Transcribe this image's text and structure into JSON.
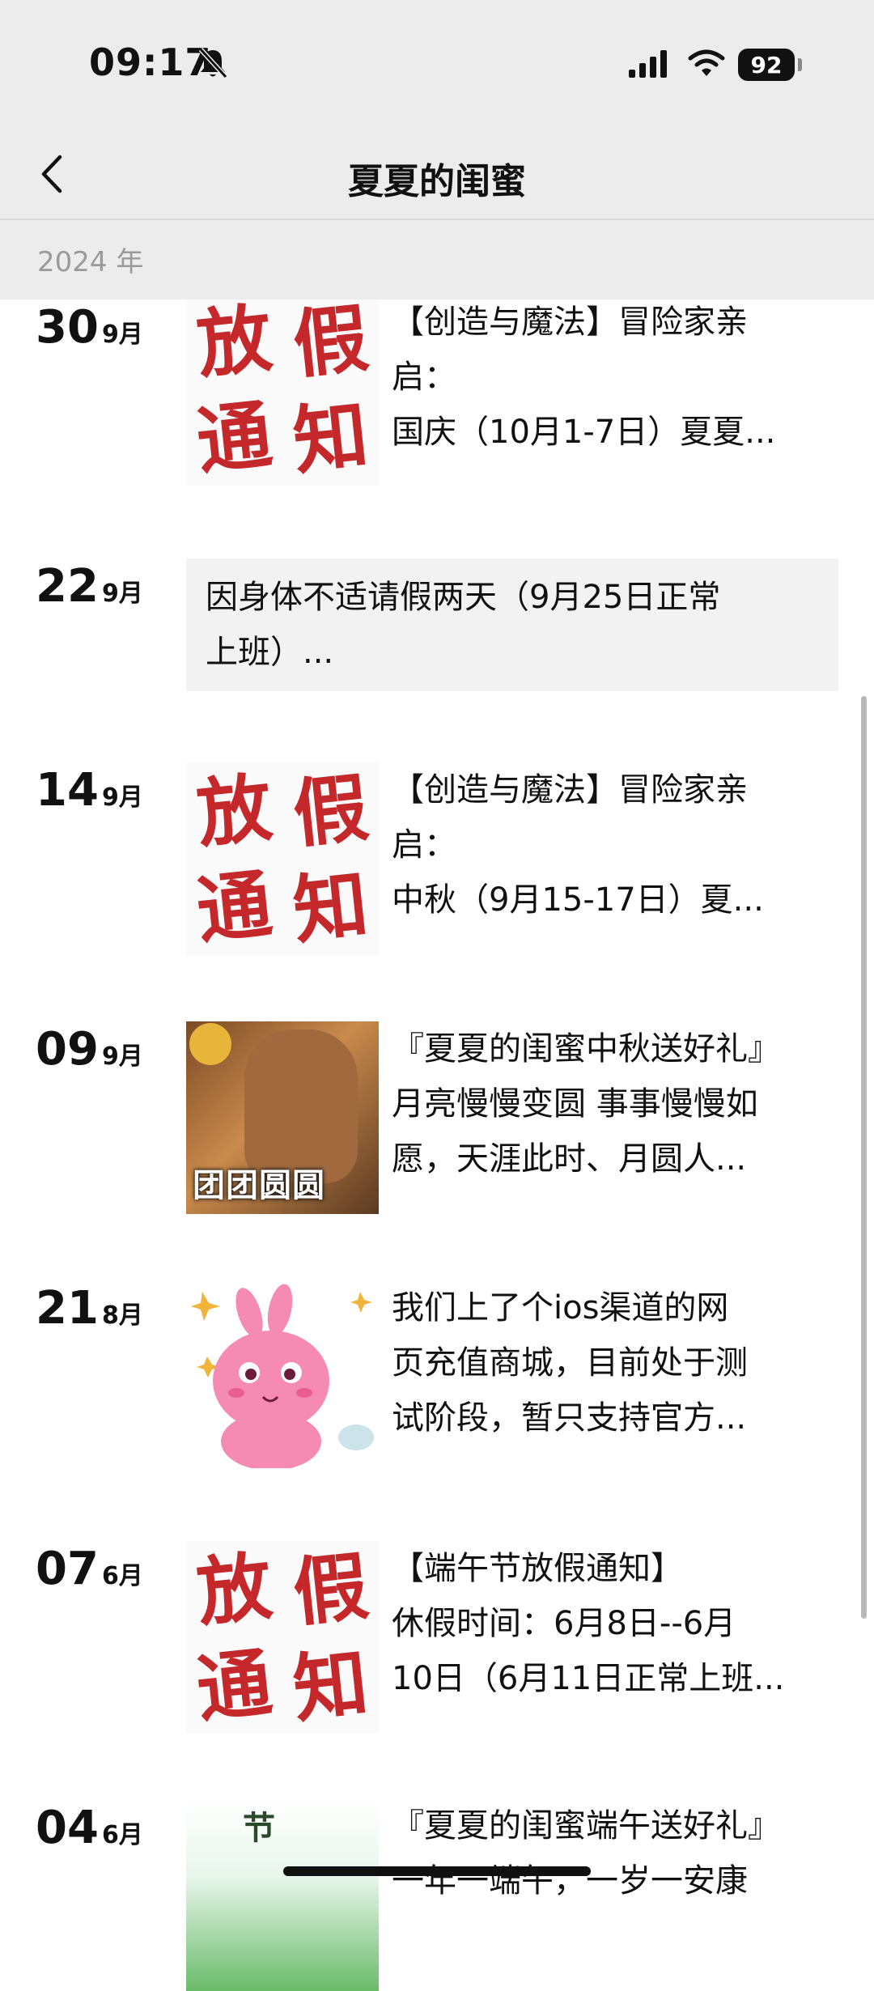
{
  "status": {
    "time": "09:17",
    "battery": "92"
  },
  "nav": {
    "title": "夏夏的闺蜜"
  },
  "year_label": "2024 年",
  "posts": [
    {
      "day": "30",
      "month": "9月",
      "thumb": "holiday-notice",
      "thumb_chars": [
        "放",
        "假",
        "通",
        "知"
      ],
      "lines": [
        "【创造与魔法】冒险家亲",
        "启：",
        "国庆（10月1-7日）夏夏..."
      ]
    },
    {
      "day": "22",
      "month": "9月",
      "thumb": "none",
      "lines": [
        "因身体不适请假两天（9月25日正常",
        "上班）..."
      ]
    },
    {
      "day": "14",
      "month": "9月",
      "thumb": "holiday-notice",
      "thumb_chars": [
        "放",
        "假",
        "通",
        "知"
      ],
      "lines": [
        "【创造与魔法】冒险家亲",
        "启：",
        "中秋（9月15-17日）夏..."
      ]
    },
    {
      "day": "09",
      "month": "9月",
      "thumb": "mid-autumn-photo",
      "thumb_label": "团团圆圆",
      "lines": [
        "『夏夏的闺蜜中秋送好礼』",
        "月亮慢慢变圆 事事慢慢如",
        "愿，天涯此时、月圆人..."
      ]
    },
    {
      "day": "21",
      "month": "8月",
      "thumb": "pink-rabbit-sticker",
      "lines": [
        "我们上了个ios渠道的网",
        "页充值商城，目前处于测",
        "试阶段，暂只支持官方..."
      ]
    },
    {
      "day": "07",
      "month": "6月",
      "thumb": "holiday-notice",
      "thumb_chars": [
        "放",
        "假",
        "通",
        "知"
      ],
      "lines": [
        "【端午节放假通知】",
        "休假时间：6月8日--6月",
        "10日（6月11日正常上班..."
      ]
    },
    {
      "day": "04",
      "month": "6月",
      "thumb": "dragon-boat-image",
      "thumb_label": "节",
      "lines": [
        "『夏夏的闺蜜端午送好礼』",
        "一年一端午，一岁一安康"
      ]
    }
  ],
  "colors": {
    "topbar_bg": "#ececec",
    "notice_red": "#c4282a",
    "text_box_bg": "#f2f2f2"
  }
}
